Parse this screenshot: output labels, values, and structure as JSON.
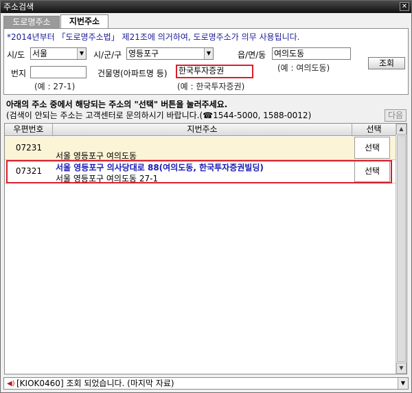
{
  "window": {
    "title": "주소검색",
    "close_label": "✕"
  },
  "tabs": [
    {
      "label": "도로명주소",
      "active": false
    },
    {
      "label": "지번주소",
      "active": true
    }
  ],
  "notice": "*2014년부터 「도로명주소법」 제21조에 의거하여, 도로명주소가 의무 사용됩니다.",
  "form": {
    "sido_label": "시/도",
    "sido_value": "서울",
    "sigungu_label": "시/군/구",
    "sigungu_value": "영등포구",
    "eup_label": "읍/면/동",
    "eup_value": "여의도동",
    "eup_hint": "(예 : 여의도동)",
    "search_button": "조회",
    "bunji_label": "번지",
    "bunji_value": "",
    "bunji_hint": "(예 : 27-1)",
    "building_label": "건물명(아파트명 등)",
    "building_value": "한국투자증권",
    "building_hint": "(예 : 한국투자증권)"
  },
  "instructions": {
    "line1": "아래의 주소 중에서 해당되는 주소의 \"선택\" 버튼을 눌러주세요.",
    "line2": "(검색이 안되는 주소는 고객센터로 문의하시기 바랍니다.(☎1544-5000, 1588-0012)",
    "next_button": "다음"
  },
  "table": {
    "columns": [
      "우편번호",
      "지번주소",
      "선택"
    ],
    "rows": [
      {
        "zip": "07231",
        "road": "",
        "jibun": "서울 영등포구 여의도동",
        "select": "선택"
      },
      {
        "zip": "07321",
        "road": "서울 영등포구 의사당대로 88(여의도동, 한국투자증권빌딩)",
        "jibun": "서울 영등포구 여의도동   27-1",
        "select": "선택"
      }
    ]
  },
  "status": {
    "message": "[KIOK0460] 조회 되었습니다. (마지막 자료)"
  },
  "colors": {
    "highlight": "#d81e2a",
    "selected_row": "#fbf4d6",
    "road_text": "#1a1ab4"
  }
}
